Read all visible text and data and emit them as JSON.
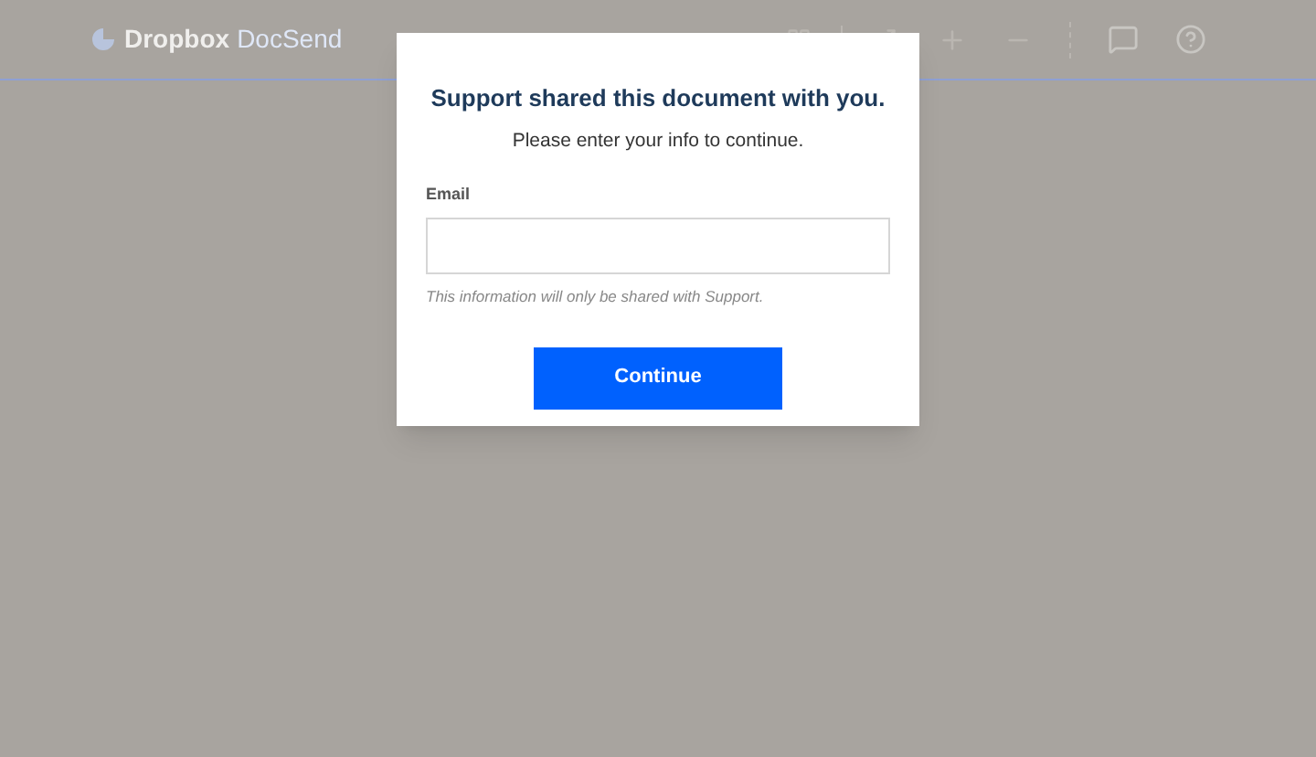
{
  "header": {
    "brand": "Dropbox",
    "product": "DocSend"
  },
  "dialog": {
    "title": "Support shared this document with you.",
    "subtitle": "Please enter your info to continue.",
    "email_label": "Email",
    "note": "This information will only be shared with Support.",
    "button": "Continue"
  }
}
